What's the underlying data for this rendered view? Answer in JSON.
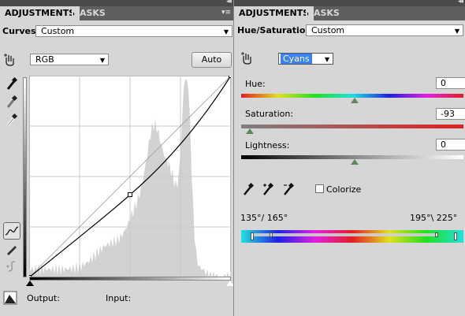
{
  "curves_panel": {
    "tabs": [
      "ADJUSTMENTS",
      "MASKS"
    ],
    "title": "Curves",
    "preset": "Custom",
    "channel": "RGB",
    "auto_label": "Auto",
    "output_label": "Output:",
    "input_label": "Input:",
    "curve_points": [
      [
        0,
        0
      ],
      [
        0.5,
        0.41
      ],
      [
        1,
        1
      ]
    ]
  },
  "huesat_panel": {
    "tabs": [
      "ADJUSTMENTS",
      "MASKS"
    ],
    "title": "Hue/Saturation",
    "preset": "Custom",
    "range": "Cyans",
    "hue_label": "Hue:",
    "hue_value": "0",
    "saturation_label": "Saturation:",
    "saturation_value": "-93",
    "lightness_label": "Lightness:",
    "lightness_value": "0",
    "colorize_label": "Colorize",
    "colorize_checked": false,
    "range_left_label": "135°/ 165°",
    "range_right_label": "195°\\ 225°"
  },
  "colors": {
    "selected_dropdown": "#3b82f0",
    "panel_bg": "#d6d6d6",
    "tab_bar": "#5f5f5f"
  },
  "icons": [
    "hand-target-icon",
    "eyedropper-black-icon",
    "eyedropper-gray-icon",
    "eyedropper-white-icon",
    "curve-draw-icon",
    "pencil-icon",
    "smooth-icon",
    "clipping-warning-icon",
    "eyedropper-plus-icon",
    "eyedropper-minus-icon",
    "panel-menu-icon",
    "collapse-icon"
  ]
}
